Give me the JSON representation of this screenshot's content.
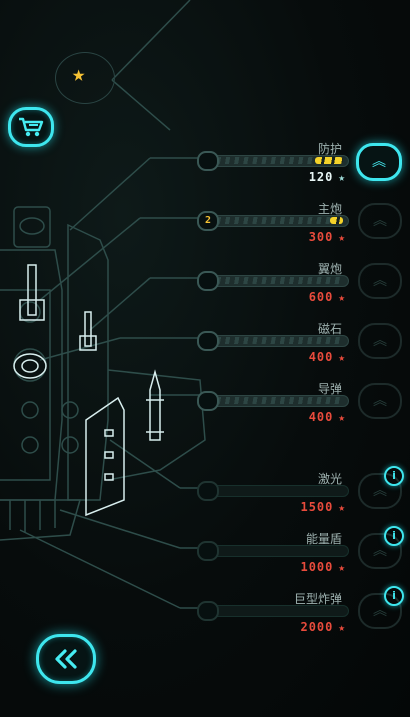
{
  "icons": {
    "star": "star-icon",
    "cart": "shopping-cart-icon",
    "back": "double-chevron-left-icon",
    "upgrade": "double-chevron-up-icon",
    "info": "info-icon",
    "coin_star": "star-icon"
  },
  "colors": {
    "accent": "#3ee6ee",
    "gold": "#f6c234",
    "cost_red": "#e84b3c",
    "bar_fill": "#f4d22a"
  },
  "glyphs": {
    "star": "★",
    "up": "︽",
    "info": "i"
  },
  "upgrades": [
    {
      "label": "防护",
      "level": "",
      "cost": "120",
      "fill_fraction": 0.22,
      "unlocked": true,
      "upgrade_active": true,
      "has_info": false
    },
    {
      "label": "主炮",
      "level": "2",
      "cost": "300",
      "fill_fraction": 0.1,
      "unlocked": true,
      "upgrade_active": false,
      "has_info": false
    },
    {
      "label": "翼炮",
      "level": "",
      "cost": "600",
      "fill_fraction": 0,
      "unlocked": true,
      "upgrade_active": false,
      "has_info": false
    },
    {
      "label": "磁石",
      "level": "",
      "cost": "400",
      "fill_fraction": 0,
      "unlocked": true,
      "upgrade_active": false,
      "has_info": false
    },
    {
      "label": "导弹",
      "level": "",
      "cost": "400",
      "fill_fraction": 0,
      "unlocked": true,
      "upgrade_active": false,
      "has_info": false
    },
    {
      "label": "激光",
      "level": "",
      "cost": "1500",
      "fill_fraction": 0,
      "unlocked": false,
      "upgrade_active": false,
      "has_info": true
    },
    {
      "label": "能量盾",
      "level": "",
      "cost": "1000",
      "fill_fraction": 0,
      "unlocked": false,
      "upgrade_active": false,
      "has_info": true
    },
    {
      "label": "巨型炸弹",
      "level": "",
      "cost": "2000",
      "fill_fraction": 0,
      "unlocked": false,
      "upgrade_active": false,
      "has_info": true
    }
  ]
}
